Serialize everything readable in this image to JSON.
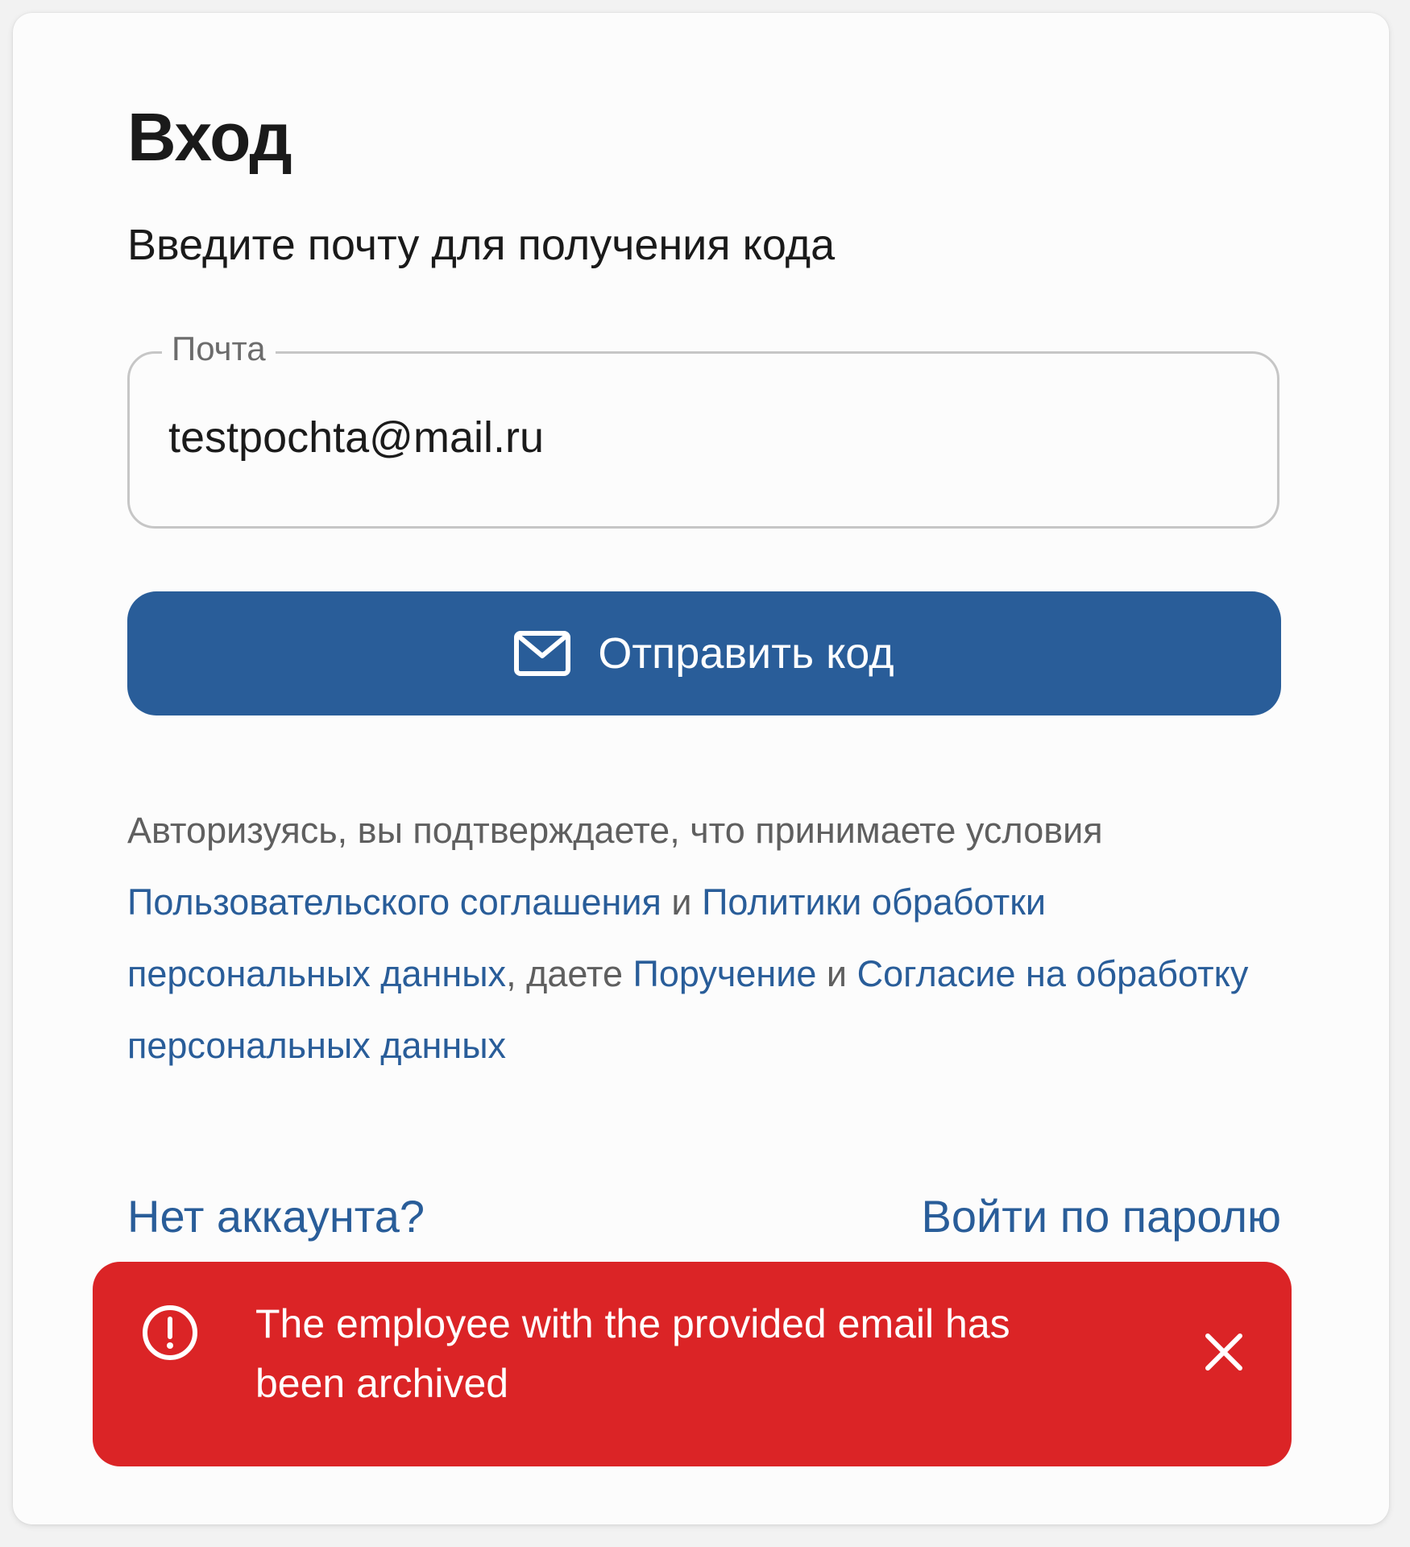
{
  "login": {
    "title": "Вход",
    "subtitle": "Введите почту для получения кода",
    "email_label": "Почта",
    "email_value": "testpochta@mail.ru",
    "send_button_label": "Отправить код",
    "send_button_icon": "envelope-icon"
  },
  "terms": {
    "prefix": "Авторизуясь, вы подтверждаете, что принимаете условия ",
    "user_agreement_link": "Пользовательского соглашения",
    "and_1": " и ",
    "privacy_policy_link": "Политики обработки персональных данных",
    "comma_give": ", даете ",
    "assignment_link": "Поручение",
    "and_2": " и ",
    "consent_link": "Согласие на обработку персональных данных"
  },
  "footer": {
    "no_account_link": "Нет аккаунта?",
    "password_login_link": "Войти по паролю"
  },
  "toast": {
    "message": "The employee with the provided email has been archived",
    "icon": "alert-circle-icon",
    "close_icon": "close-icon"
  },
  "colors": {
    "accent": "#295d99",
    "error": "#db2426",
    "card_background": "#fcfcfc",
    "page_background": "#f2f2f2"
  }
}
